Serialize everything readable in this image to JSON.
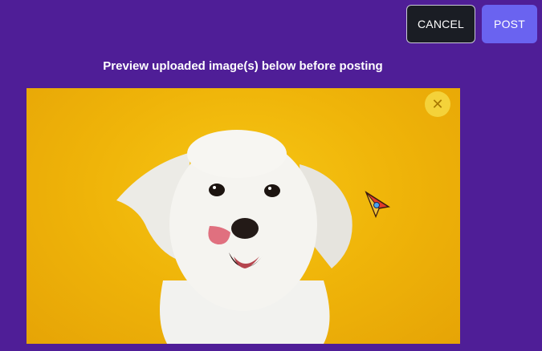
{
  "header": {
    "cancel_label": "CANCEL",
    "post_label": "POST"
  },
  "preview": {
    "title": "Preview uploaded image(s) below before posting",
    "remove_icon": "close-icon",
    "image_icon": "dog-photo"
  },
  "colors": {
    "background": "#4f1e97",
    "post_button": "#6a63f0",
    "cancel_button": "#1a1d24",
    "image_backdrop": "#efb409"
  }
}
